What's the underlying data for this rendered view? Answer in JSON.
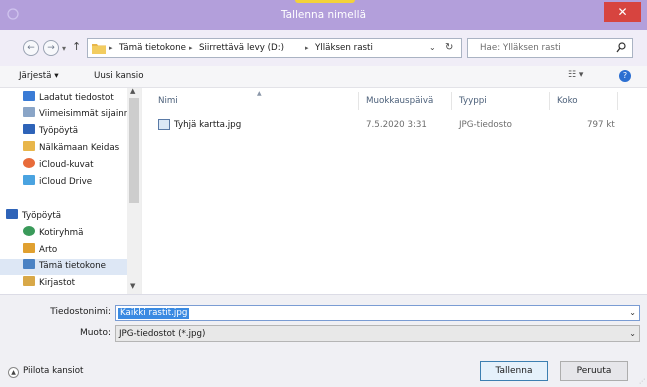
{
  "window": {
    "title": "Tallenna nimellä",
    "close_label": "✕"
  },
  "nav": {
    "back": "←",
    "forward": "→",
    "up": "↑",
    "breadcrumb": [
      "Tämä tietokone",
      "Siirrettävä levy (D:)",
      "Ylläksen rasti"
    ],
    "search_placeholder": "Hae: Ylläksen rasti"
  },
  "toolbar": {
    "organize": "Järjestä ▾",
    "new_folder": "Uusi kansio"
  },
  "sidebar": {
    "items": [
      {
        "label": "Ladatut tiedostot",
        "icon": "downloads-icon",
        "color": "#3a7bd5"
      },
      {
        "label": "Viimeisimmät sijainnit",
        "icon": "recent-places-icon",
        "color": "#8aa5c7"
      },
      {
        "label": "Työpöytä",
        "icon": "desktop-icon",
        "color": "#2e63b8"
      },
      {
        "label": "Nälkämaan Keidas",
        "icon": "folder-icon",
        "color": "#e8b64a"
      },
      {
        "label": "iCloud-kuvat",
        "icon": "icloud-photos-icon",
        "color": "#e86b3a"
      },
      {
        "label": "iCloud Drive",
        "icon": "icloud-drive-icon",
        "color": "#4aa3e0"
      }
    ],
    "groups": [
      {
        "label": "Työpöytä",
        "icon": "desktop-icon",
        "color": "#2e63b8"
      },
      {
        "label": "Kotiryhmä",
        "icon": "homegroup-icon",
        "color": "#3a9a5a"
      },
      {
        "label": "Arto",
        "icon": "user-folder-icon",
        "color": "#e0a030"
      },
      {
        "label": "Tämä tietokone",
        "icon": "computer-icon",
        "color": "#4a82c4"
      },
      {
        "label": "Kirjastot",
        "icon": "libraries-icon",
        "color": "#d8a848"
      }
    ]
  },
  "files": {
    "columns": [
      "Nimi",
      "Muokkauspäivä",
      "Tyyppi",
      "Koko"
    ],
    "rows": [
      {
        "name": "Tyhjä kartta.jpg",
        "modified": "7.5.2020 3:31",
        "type": "JPG-tiedosto",
        "size": "797 kt"
      }
    ]
  },
  "form": {
    "filename_label": "Tiedostonimi:",
    "filename_value": "Kaikki rastit.jpg",
    "filetype_label": "Muoto:",
    "filetype_value": "JPG-tiedostot (*.jpg)"
  },
  "footer": {
    "hide_folders": "Piilota kansiot",
    "save": "Tallenna",
    "cancel": "Peruuta"
  }
}
